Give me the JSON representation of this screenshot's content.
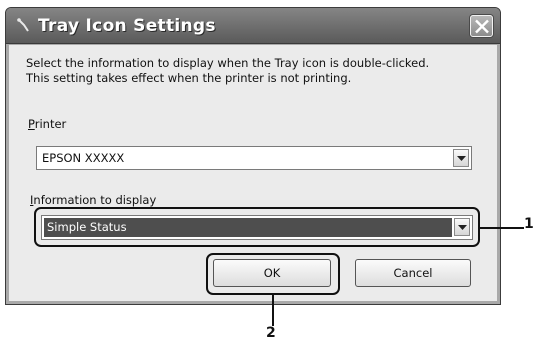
{
  "window": {
    "title": "Tray Icon Settings",
    "title_icon": "tray-icon",
    "close_icon": "close-icon"
  },
  "description": "Select the information to display when the Tray icon is double-clicked. This setting takes effect when the printer is not printing.",
  "printer": {
    "label_prefix": "P",
    "label_rest": "rinter",
    "selected": "EPSON XXXXX"
  },
  "info": {
    "label_prefix": "I",
    "label_rest": "nformation to display",
    "selected": "Simple Status"
  },
  "buttons": {
    "ok": "OK",
    "cancel": "Cancel"
  },
  "callouts": {
    "one": "1",
    "two": "2"
  }
}
